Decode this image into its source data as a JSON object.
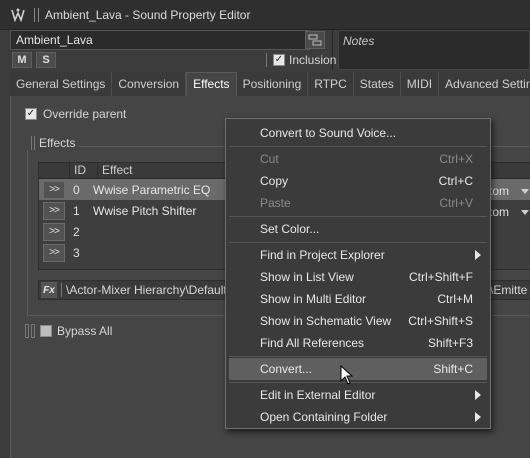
{
  "window": {
    "title": "Ambient_Lava - Sound Property Editor",
    "icon": "wwise-app-icon"
  },
  "object_name": "Ambient_Lava",
  "notes_placeholder": "Notes",
  "buttons": {
    "mute": "M",
    "solo": "S"
  },
  "inclusion": {
    "label": "Inclusion",
    "checked": true
  },
  "tabs": [
    {
      "label": "General Settings",
      "active": false
    },
    {
      "label": "Conversion",
      "active": false
    },
    {
      "label": "Effects",
      "active": true
    },
    {
      "label": "Positioning",
      "active": false
    },
    {
      "label": "RTPC",
      "active": false
    },
    {
      "label": "States",
      "active": false
    },
    {
      "label": "MIDI",
      "active": false
    },
    {
      "label": "Advanced Settings",
      "active": false
    }
  ],
  "override_parent": {
    "label": "Override parent",
    "checked": true
  },
  "effects_group": {
    "title": "Effects",
    "columns": {
      "id": "ID",
      "effect": "Effect"
    },
    "rows": [
      {
        "btn": ">>",
        "id": "0",
        "effect": "Wwise Parametric EQ",
        "selected": true,
        "custom": "tom"
      },
      {
        "btn": ">>",
        "id": "1",
        "effect": "Wwise Pitch Shifter",
        "selected": false,
        "custom": "tom"
      },
      {
        "btn": ">>",
        "id": "2",
        "effect": "",
        "selected": false
      },
      {
        "btn": ">>",
        "id": "3",
        "effect": "",
        "selected": false
      }
    ],
    "path_left": "\\Actor-Mixer Hierarchy\\Default W",
    "path_right": "s\\Emitte"
  },
  "bypass_all": {
    "label": "Bypass All",
    "checked": false
  },
  "context_menu": {
    "items": [
      {
        "label": "Convert to Sound Voice...",
        "shortcut": "",
        "disabled": false,
        "submenu": false
      },
      {
        "sep": true
      },
      {
        "label": "Cut",
        "shortcut": "Ctrl+X",
        "disabled": true,
        "submenu": false
      },
      {
        "label": "Copy",
        "shortcut": "Ctrl+C",
        "disabled": false,
        "submenu": false
      },
      {
        "label": "Paste",
        "shortcut": "Ctrl+V",
        "disabled": true,
        "submenu": false
      },
      {
        "sep": true
      },
      {
        "label": "Set Color...",
        "shortcut": "",
        "disabled": false,
        "submenu": false
      },
      {
        "sep": true
      },
      {
        "label": "Find in Project Explorer",
        "shortcut": "",
        "disabled": false,
        "submenu": true
      },
      {
        "label": "Show in List View",
        "shortcut": "Ctrl+Shift+F",
        "disabled": false,
        "submenu": false
      },
      {
        "label": "Show in Multi Editor",
        "shortcut": "Ctrl+M",
        "disabled": false,
        "submenu": false
      },
      {
        "label": "Show in Schematic View",
        "shortcut": "Ctrl+Shift+S",
        "disabled": false,
        "submenu": false
      },
      {
        "label": "Find All References",
        "shortcut": "Shift+F3",
        "disabled": false,
        "submenu": false
      },
      {
        "sep": true
      },
      {
        "label": "Convert...",
        "shortcut": "Shift+C",
        "disabled": false,
        "submenu": false,
        "hover": true
      },
      {
        "sep": true
      },
      {
        "label": "Edit in External Editor",
        "shortcut": "",
        "disabled": false,
        "submenu": true
      },
      {
        "label": "Open Containing Folder",
        "shortcut": "",
        "disabled": false,
        "submenu": true
      }
    ]
  },
  "colors": {
    "background": "#3c3c3c",
    "panel": "#454545",
    "menu": "#3b3b3b",
    "highlight": "#5f5f5f",
    "disabled_text": "#8a8a8a"
  }
}
